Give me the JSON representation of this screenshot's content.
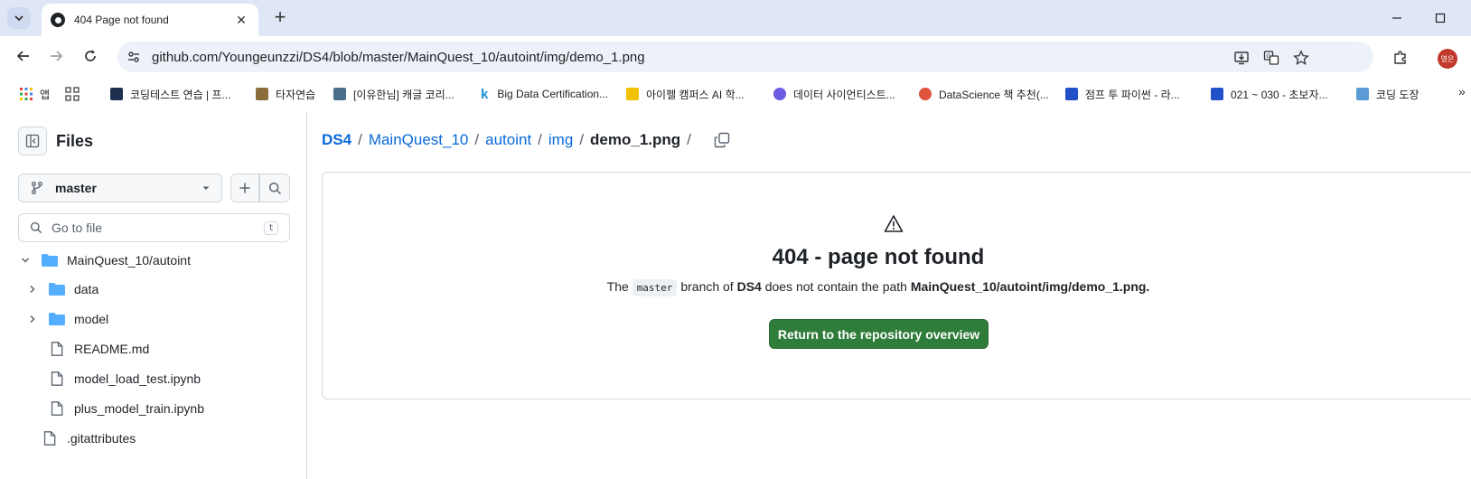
{
  "browser": {
    "tab": {
      "title": "404 Page not found"
    },
    "url": "github.com/Youngeunzzi/DS4/blob/master/MainQuest_10/autoint/img/demo_1.png",
    "profile_initials": "영은",
    "bookmarks": [
      {
        "label": "앱",
        "icon": "apps-grid-icon",
        "color": "#ea4335"
      },
      {
        "label": "",
        "icon": "grid-icon",
        "color": "#5f6368"
      },
      {
        "label": "코딩테스트 연습 | 프...",
        "icon": "programmers-icon",
        "color": "#1e3050"
      },
      {
        "label": "타자연습",
        "icon": "typing-icon",
        "color": "#8a6d3b"
      },
      {
        "label": "[이유한님] 캐글 코리...",
        "icon": "kaggle-korea-icon",
        "color": "#4a6f8a"
      },
      {
        "label": "Big Data Certification...",
        "icon": "k-icon",
        "color": "#1a8fd8"
      },
      {
        "label": "아이펠 캠퍼스 AI 학...",
        "icon": "aiffel-icon",
        "color": "#f2c200"
      },
      {
        "label": "데이터 사이언티스트...",
        "icon": "hexagon-icon",
        "color": "#6a5be2"
      },
      {
        "label": "DataScience 책 추천(...",
        "icon": "ds-book-icon",
        "color": "#e0533d"
      },
      {
        "label": "점프 투 파이썬 - 라...",
        "icon": "wikidocs-icon",
        "color": "#2250c8"
      },
      {
        "label": "021 ~ 030 - 초보자...",
        "icon": "wikidocs-icon",
        "color": "#2250c8"
      },
      {
        "label": "코딩 도장",
        "icon": "dojang-icon",
        "color": "#5b9bd5"
      }
    ]
  },
  "sidebar": {
    "title": "Files",
    "branch": "master",
    "search_placeholder": "Go to file",
    "search_shortcut": "t",
    "tree": [
      {
        "label": "MainQuest_10/autoint",
        "type": "folder",
        "expanded": true
      },
      {
        "label": "data",
        "type": "folder",
        "expanded": false
      },
      {
        "label": "model",
        "type": "folder",
        "expanded": false
      },
      {
        "label": "README.md",
        "type": "file"
      },
      {
        "label": "model_load_test.ipynb",
        "type": "file"
      },
      {
        "label": "plus_model_train.ipynb",
        "type": "file"
      },
      {
        "label": ".gitattributes",
        "type": "file"
      }
    ]
  },
  "main": {
    "breadcrumb": {
      "repo": "DS4",
      "parts": [
        "MainQuest_10",
        "autoint",
        "img"
      ],
      "current": "demo_1.png",
      "sep": "/"
    },
    "not_found": {
      "heading": "404 - page not found",
      "desc_the": "The",
      "branch": "master",
      "desc_mid": "branch of",
      "repo": "DS4",
      "desc_tail": "does not contain the path",
      "path": "MainQuest_10/autoint/img/demo_1.png.",
      "button": "Return to the repository overview"
    }
  },
  "colors": {
    "link": "#0969da",
    "primary_button": "#2f7d3a",
    "border": "#d1d9e0",
    "folder": "#54aeff",
    "tabstrip": "#dfe7f7"
  }
}
